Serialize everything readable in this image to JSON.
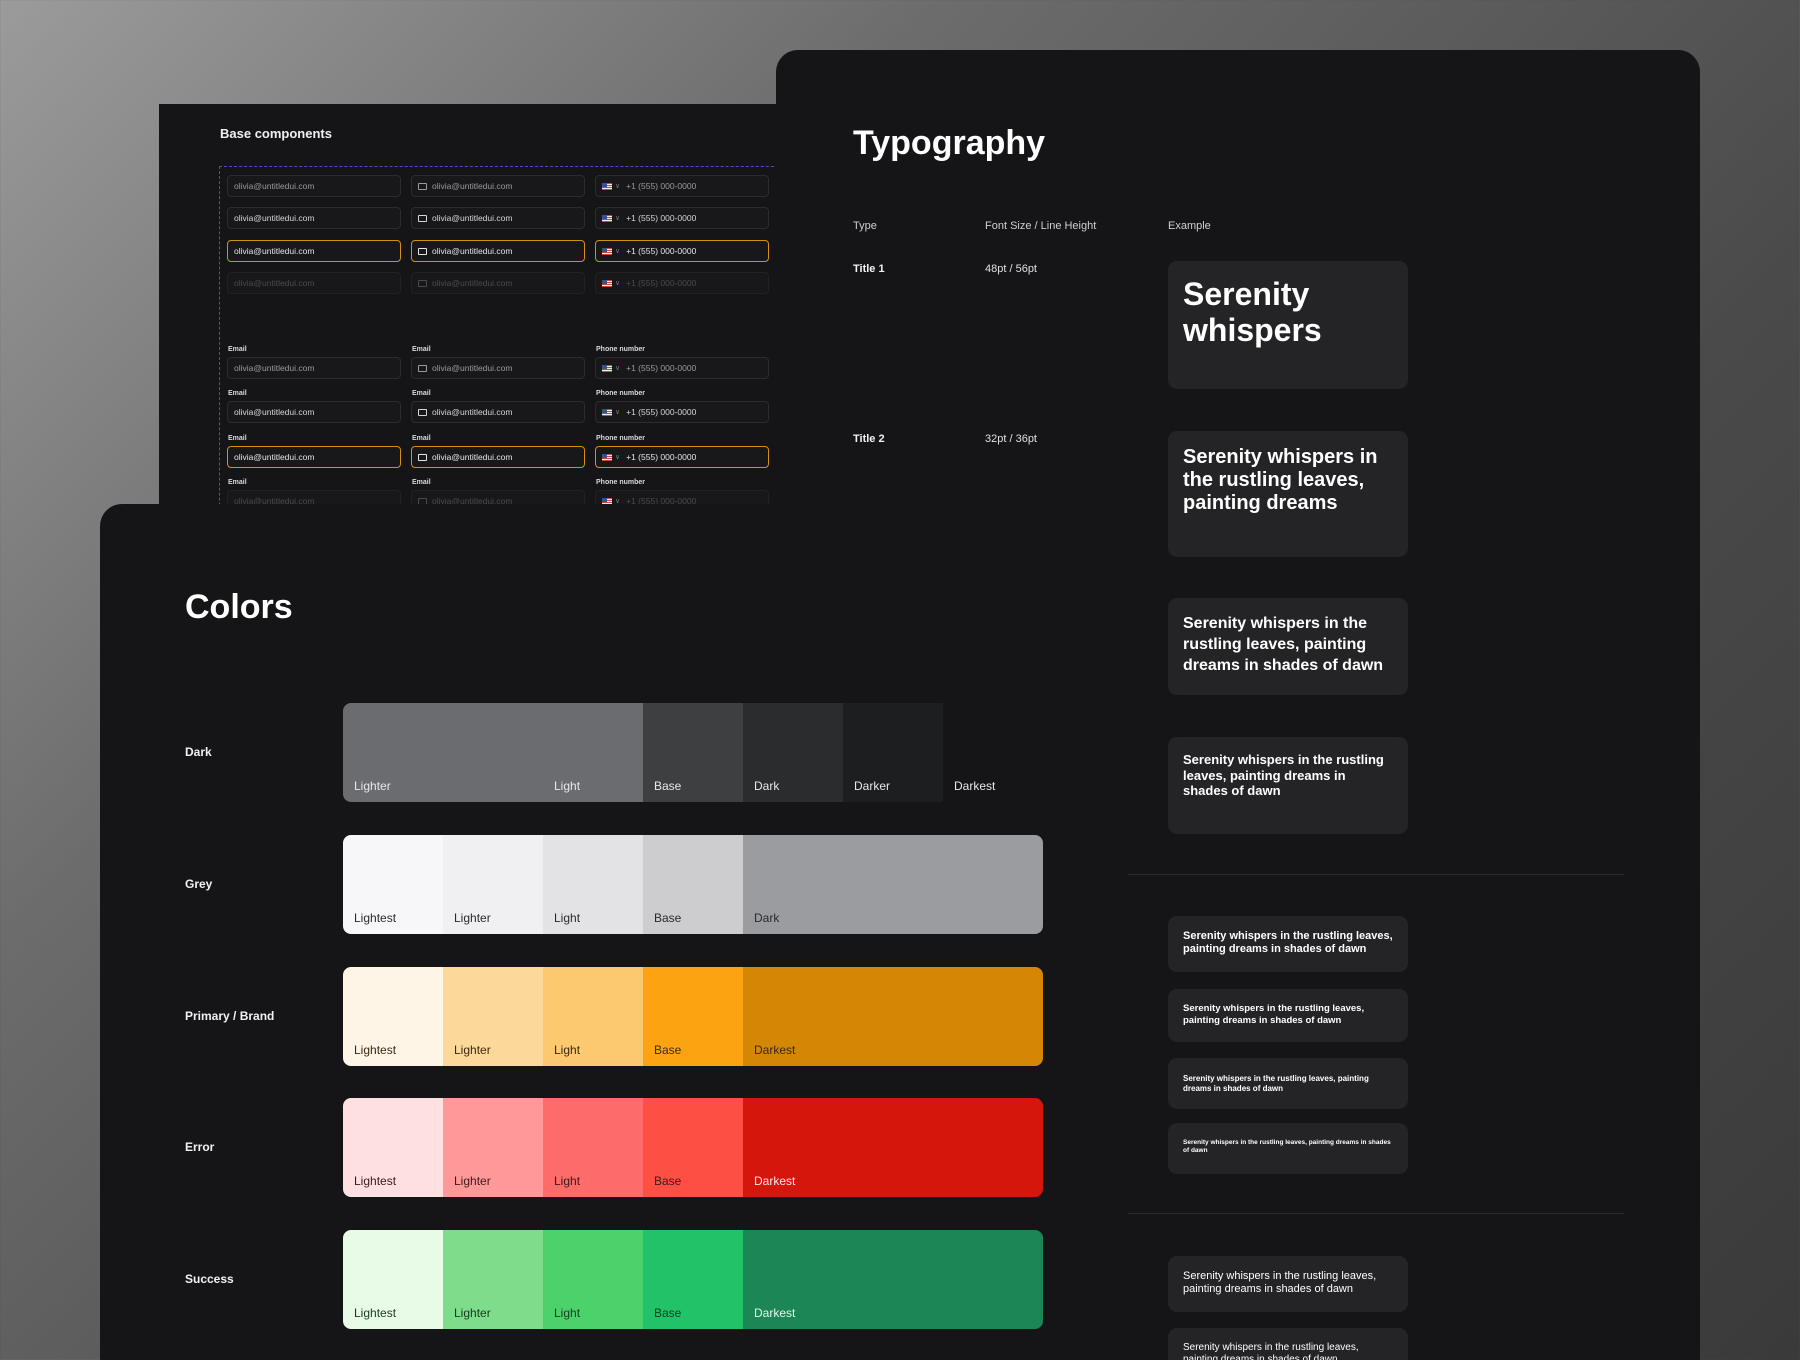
{
  "base_components": {
    "title": "Base components",
    "placeholder_email": "olivia@untitledui.com",
    "placeholder_phone": "+1 (555) 000-0000",
    "label_email": "Email",
    "label_phone": "Phone number"
  },
  "typography": {
    "title": "Typography",
    "columns": [
      "Type",
      "Font Size / Line Height",
      "Example"
    ],
    "rows": [
      {
        "type": "Title 1",
        "size": "48pt / 56pt",
        "example": "Serenity whispers"
      },
      {
        "type": "Title 2",
        "size": "32pt / 36pt",
        "example": "Serenity whispers in the rustling leaves, painting dreams"
      }
    ],
    "examples": [
      "Serenity whispers in the rustling leaves, painting dreams in shades of dawn",
      "Serenity whispers in the rustling leaves, painting dreams in shades of dawn",
      "Serenity whispers in the rustling leaves, painting dreams in shades of dawn",
      "Serenity whispers in the rustling leaves, painting dreams in shades of dawn",
      "Serenity whispers in the rustling leaves, painting dreams in shades of dawn",
      "Serenity whispers in the rustling leaves, painting dreams in shades of dawn",
      "Serenity whispers in the rustling leaves, painting dreams in shades of dawn",
      "Serenity whispers in the rustling leaves, painting dreams in shades of dawn"
    ]
  },
  "colors": {
    "title": "Colors",
    "palettes": [
      {
        "name": "Dark",
        "swatches": [
          {
            "label": "Lighter",
            "color": "#6b6c6f",
            "text": "#e8e8e8"
          },
          {
            "label": "Light",
            "color": "#6b6c6f",
            "text": "#e8e8e8"
          },
          {
            "label": "Base",
            "color": "#3d3f41",
            "text": "#e8e8e8"
          },
          {
            "label": "Dark",
            "color": "#2a2c2e",
            "text": "#e8e8e8"
          },
          {
            "label": "Darker",
            "color": "#1c1e1f",
            "text": "#e8e8e8"
          },
          {
            "label": "Darkest",
            "color": "#151518",
            "text": "#e8e8e8"
          }
        ]
      },
      {
        "name": "Grey",
        "swatches": [
          {
            "label": "Lightest",
            "color": "#f7f7f9",
            "text": "#2a2a2a"
          },
          {
            "label": "Lighter",
            "color": "#f0f0f2",
            "text": "#2a2a2a"
          },
          {
            "label": "Light",
            "color": "#e3e3e6",
            "text": "#2a2a2a"
          },
          {
            "label": "Base",
            "color": "#cdcdd0",
            "text": "#2a2a2a"
          },
          {
            "label": "Dark",
            "color": "#9a9c9f",
            "text": "#2a2a2a"
          }
        ]
      },
      {
        "name": "Primary / Brand",
        "swatches": [
          {
            "label": "Lightest",
            "color": "#fef5e6",
            "text": "#3a2a10"
          },
          {
            "label": "Lighter",
            "color": "#fdd89b",
            "text": "#3a2a10"
          },
          {
            "label": "Light",
            "color": "#fcc870",
            "text": "#3a2a10"
          },
          {
            "label": "Base",
            "color": "#fca311",
            "text": "#3a2a10"
          },
          {
            "label": "Darkest",
            "color": "#d48605",
            "text": "#3a2a10"
          }
        ]
      },
      {
        "name": "Error",
        "swatches": [
          {
            "label": "Lightest",
            "color": "#ffe0e0",
            "text": "#3a1a1a"
          },
          {
            "label": "Lighter",
            "color": "#ff9898",
            "text": "#3a1a1a"
          },
          {
            "label": "Light",
            "color": "#fe6b6b",
            "text": "#3a1a1a"
          },
          {
            "label": "Base",
            "color": "#fe4f44",
            "text": "#3a1a1a"
          },
          {
            "label": "Darkest",
            "color": "#d5160d",
            "text": "#fde8e8"
          }
        ]
      },
      {
        "name": "Success",
        "swatches": [
          {
            "label": "Lightest",
            "color": "#e8fbe6",
            "text": "#1a3a20"
          },
          {
            "label": "Lighter",
            "color": "#7ddd8a",
            "text": "#1a3a20"
          },
          {
            "label": "Light",
            "color": "#4cd26b",
            "text": "#1a3a20"
          },
          {
            "label": "Base",
            "color": "#21c268",
            "text": "#1a3a20"
          },
          {
            "label": "Darkest",
            "color": "#1b8656",
            "text": "#e6f8ec"
          }
        ]
      }
    ]
  }
}
